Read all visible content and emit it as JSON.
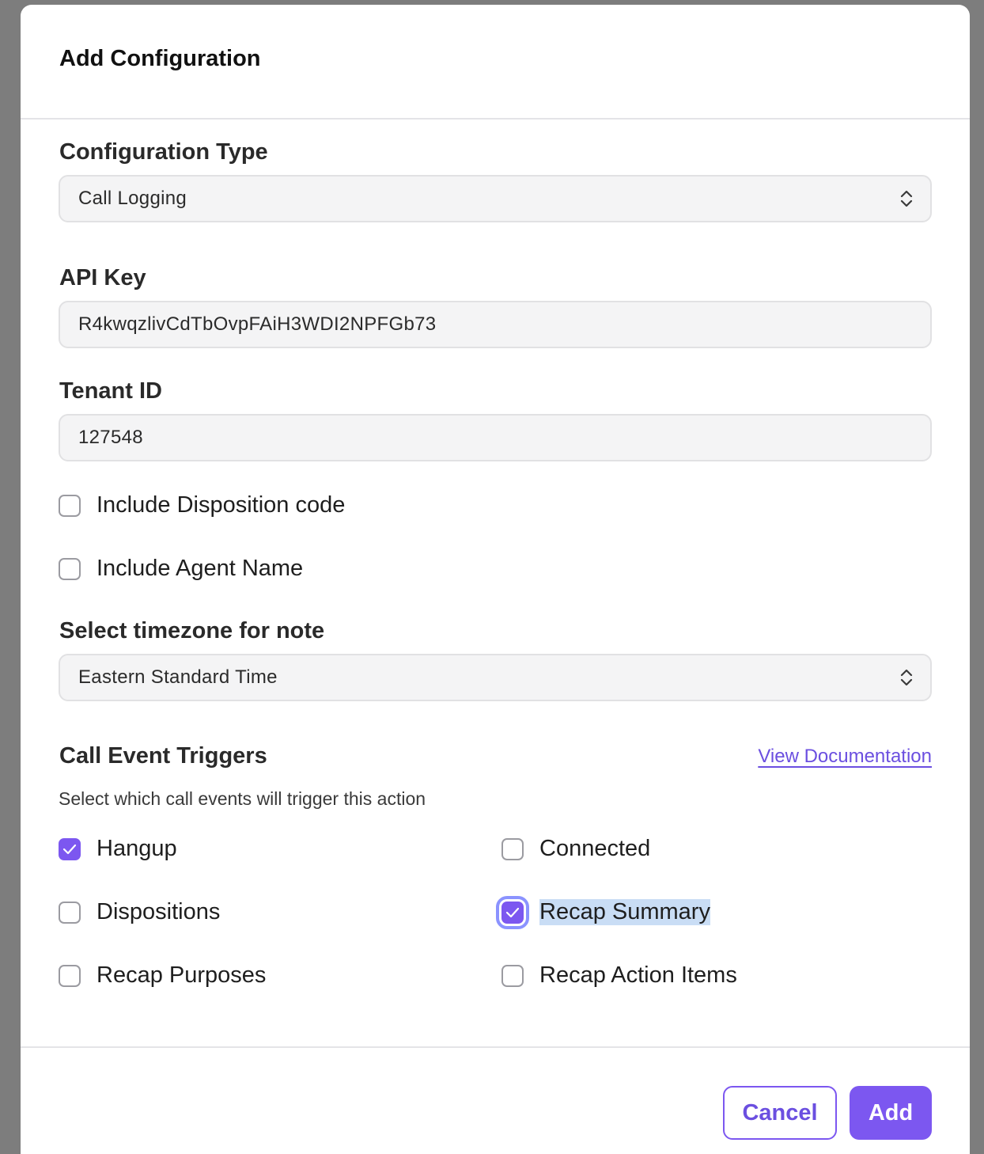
{
  "modal": {
    "title": "Add Configuration"
  },
  "configuration_type": {
    "label": "Configuration Type",
    "value": "Call Logging"
  },
  "api_key": {
    "label": "API Key",
    "value": "R4kwqzlivCdTbOvpFAiH3WDI2NPFGb73"
  },
  "tenant_id": {
    "label": "Tenant ID",
    "value": "127548"
  },
  "options": {
    "include_disposition_code": {
      "label": "Include Disposition code",
      "checked": false
    },
    "include_agent_name": {
      "label": "Include Agent Name",
      "checked": false
    }
  },
  "timezone": {
    "label": "Select timezone for note",
    "value": "Eastern Standard Time"
  },
  "triggers": {
    "title": "Call Event Triggers",
    "link": "View Documentation",
    "description": "Select which call events will trigger this action",
    "items": [
      {
        "label": "Hangup",
        "checked": true
      },
      {
        "label": "Connected",
        "checked": false
      },
      {
        "label": "Dispositions",
        "checked": false
      },
      {
        "label": "Recap Summary",
        "checked": true
      },
      {
        "label": "Recap Purposes",
        "checked": false
      },
      {
        "label": "Recap Action Items",
        "checked": false
      }
    ]
  },
  "footer": {
    "cancel_label": "Cancel",
    "add_label": "Add"
  },
  "colors": {
    "accent": "#7c57f0",
    "link": "#6b4fe0",
    "focus_ring": "#8b93ff",
    "selection": "#c9ddf5"
  },
  "icons": {
    "select_chevron": "chevron-up-down-icon",
    "checkmark": "checkmark-icon"
  }
}
